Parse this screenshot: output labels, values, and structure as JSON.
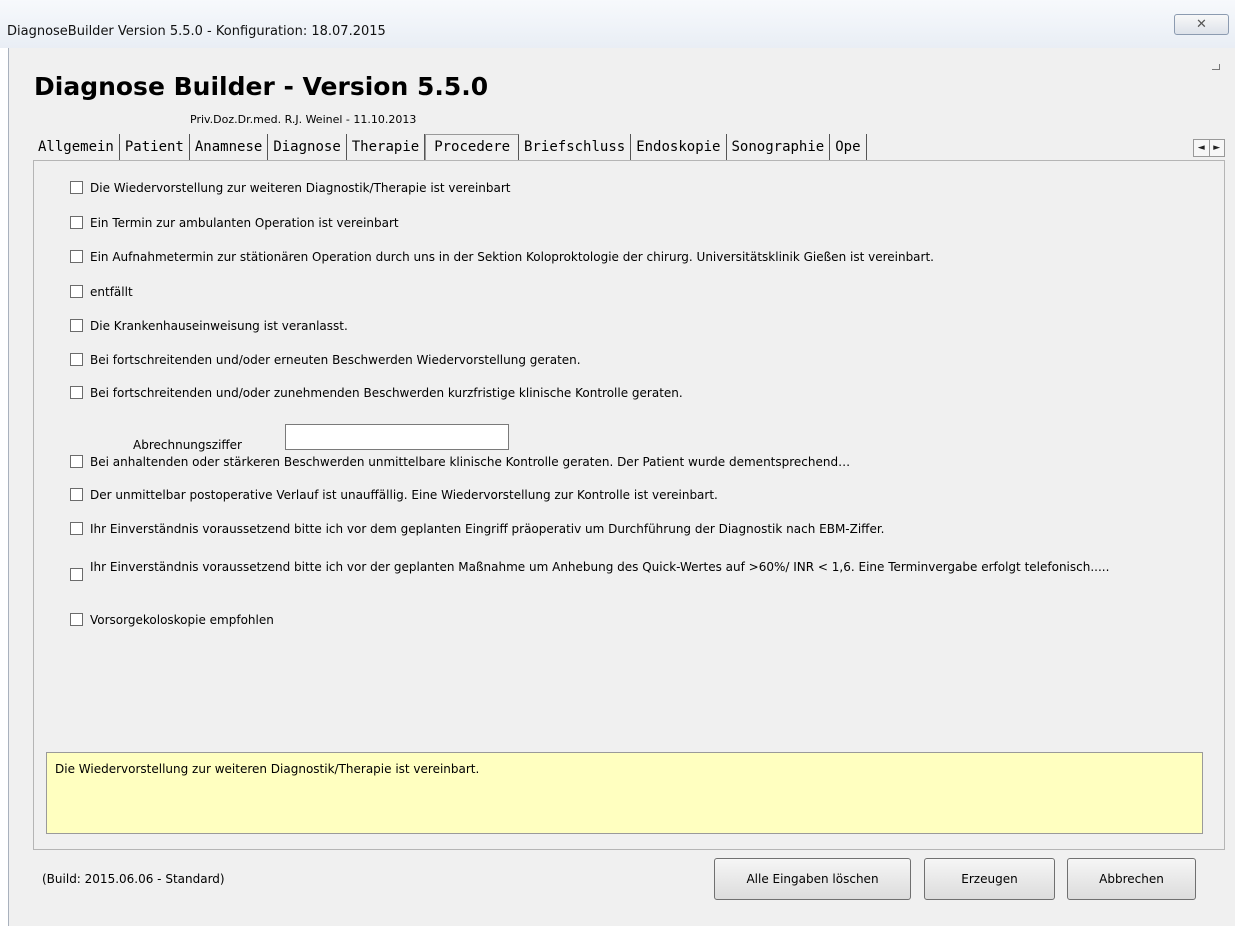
{
  "window": {
    "title": "DiagnoseBuilder Version 5.5.0 - Konfiguration: 18.07.2015",
    "close_glyph": "✕"
  },
  "header": {
    "title": "Diagnose Builder - Version 5.5.0",
    "subtitle": "Priv.Doz.Dr.med. R.J. Weinel - 11.10.2013"
  },
  "tabs": [
    {
      "label": "Allgemein",
      "active": false
    },
    {
      "label": "Patient",
      "active": false
    },
    {
      "label": "Anamnese",
      "active": false
    },
    {
      "label": "Diagnose",
      "active": false
    },
    {
      "label": "Therapie",
      "active": false
    },
    {
      "label": "Procedere",
      "active": true
    },
    {
      "label": "Briefschluss",
      "active": false
    },
    {
      "label": "Endoskopie",
      "active": false
    },
    {
      "label": "Sonographie",
      "active": false
    },
    {
      "label": "Ope",
      "active": false
    }
  ],
  "tab_scroll": {
    "left": "◄",
    "right": "►"
  },
  "checkboxes": [
    {
      "label": "Die Wiedervorstellung zur weiteren Diagnostik/Therapie ist vereinbart",
      "checked": false
    },
    {
      "label": "Ein Termin zur ambulanten Operation ist vereinbart",
      "checked": false
    },
    {
      "label": "Ein Aufnahmetermin zur stätionären Operation durch uns in der Sektion Koloproktologie der chirurg. Universitätsklinik Gießen ist vereinbart.",
      "checked": false
    },
    {
      "label": "entfällt",
      "checked": false
    },
    {
      "label": "Die Krankenhauseinweisung ist veranlasst.",
      "checked": false
    },
    {
      "label": "Bei fortschreitenden und/oder erneuten Beschwerden Wiedervorstellung geraten.",
      "checked": false
    },
    {
      "label": "Bei fortschreitenden und/oder zunehmenden Beschwerden kurzfristige klinische Kontrolle geraten.",
      "checked": false
    },
    {
      "label": "Bei anhaltenden oder stärkeren Beschwerden unmittelbare klinische Kontrolle geraten. Der Patient wurde dementsprechend…",
      "checked": false
    },
    {
      "label": "Der unmittelbar postoperative Verlauf ist unauffällig. Eine Wiedervorstellung zur Kontrolle ist vereinbart.",
      "checked": false
    },
    {
      "label": "Ihr Einverständnis voraussetzend bitte ich vor dem geplanten Eingriff präoperativ um Durchführung der Diagnostik nach EBM-Ziffer.",
      "checked": false
    },
    {
      "label": "Ihr Einverständnis voraussetzend bitte ich vor der geplanten Maßnahme um Anhebung des Quick-Wertes auf >60%/ INR < 1,6. Eine Terminvergabe erfolgt telefonisch.....",
      "checked": false
    },
    {
      "label": "Vorsorgekoloskopie empfohlen",
      "checked": false
    }
  ],
  "abrechnung": {
    "label": "Abrechnungsziffer",
    "value": ""
  },
  "preview_text": "Die Wiedervorstellung zur weiteren Diagnostik/Therapie ist vereinbart.",
  "footer": {
    "build": "(Build: 2015.06.06 - Standard)",
    "clear_label": "Alle Eingaben löschen",
    "generate_label": "Erzeugen",
    "cancel_label": "Abbrechen"
  }
}
